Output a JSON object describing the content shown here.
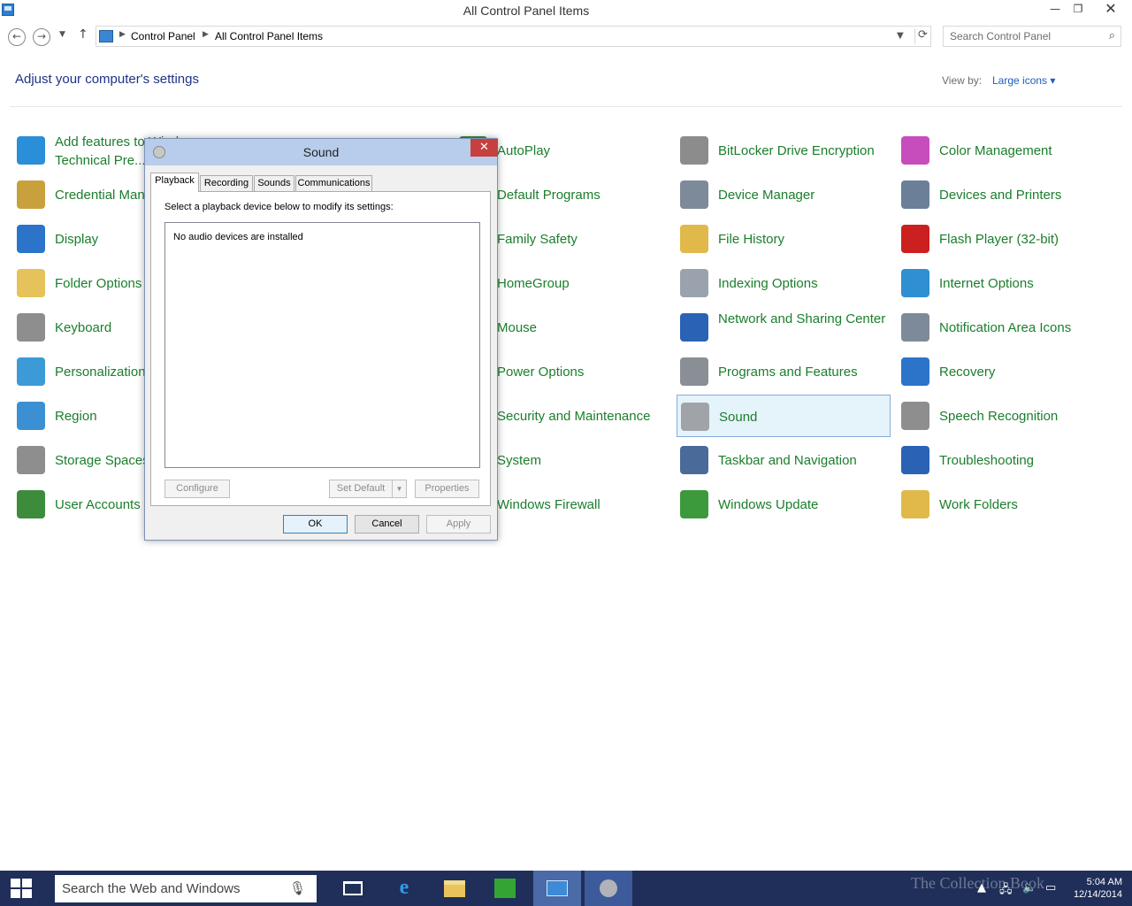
{
  "window": {
    "title": "All Control Panel Items",
    "controls": {
      "minimize": "—",
      "maximize": "❐",
      "close": "✕"
    }
  },
  "nav": {
    "back": "←",
    "forward": "→",
    "up": "↑",
    "breadcrumbs": [
      "Control Panel",
      "All Control Panel Items"
    ],
    "search_placeholder": "Search Control Panel"
  },
  "header": {
    "heading": "Adjust your computer's settings",
    "view_by_label": "View by:",
    "view_by_value": "Large icons"
  },
  "items": [
    {
      "label": "Add features to Windows Technical Pre...",
      "icon": "add-features-icon",
      "color": "#2a8ed8"
    },
    {
      "label": "AutoPlay",
      "icon": "autoplay-icon",
      "color": "#3c8c3c"
    },
    {
      "label": "BitLocker Drive Encryption",
      "icon": "bitlocker-icon",
      "color": "#8c8c8c"
    },
    {
      "label": "Color Management",
      "icon": "color-management-icon",
      "color": "#c74dbd"
    },
    {
      "label": "Credential Manager",
      "icon": "credential-manager-icon",
      "color": "#c9a13c"
    },
    {
      "label": "Default Programs",
      "icon": "default-programs-icon",
      "color": "#3a9c3a"
    },
    {
      "label": "Device Manager",
      "icon": "device-manager-icon",
      "color": "#7d8a99"
    },
    {
      "label": "Devices and Printers",
      "icon": "devices-printers-icon",
      "color": "#6b7f99"
    },
    {
      "label": "Display",
      "icon": "display-icon",
      "color": "#2b74c9"
    },
    {
      "label": "Family Safety",
      "icon": "family-safety-icon",
      "color": "#3fa13f"
    },
    {
      "label": "File History",
      "icon": "file-history-icon",
      "color": "#e1b84a"
    },
    {
      "label": "Flash Player (32-bit)",
      "icon": "flash-player-icon",
      "color": "#cc1f1f"
    },
    {
      "label": "Folder Options",
      "icon": "folder-options-icon",
      "color": "#e6c25a"
    },
    {
      "label": "HomeGroup",
      "icon": "homegroup-icon",
      "color": "#2a8ed8"
    },
    {
      "label": "Indexing Options",
      "icon": "indexing-options-icon",
      "color": "#9aa3ad"
    },
    {
      "label": "Internet Options",
      "icon": "internet-options-icon",
      "color": "#2f8fd1"
    },
    {
      "label": "Keyboard",
      "icon": "keyboard-icon",
      "color": "#8e8e8e"
    },
    {
      "label": "Mouse",
      "icon": "mouse-icon",
      "color": "#8e8e8e"
    },
    {
      "label": "Network and Sharing Center",
      "icon": "network-sharing-icon",
      "color": "#2a62b5"
    },
    {
      "label": "Notification Area Icons",
      "icon": "notification-area-icon",
      "color": "#7d8a99"
    },
    {
      "label": "Personalization",
      "icon": "personalization-icon",
      "color": "#3c9ad6"
    },
    {
      "label": "Power Options",
      "icon": "power-options-icon",
      "color": "#47a23c"
    },
    {
      "label": "Programs and Features",
      "icon": "programs-features-icon",
      "color": "#8a8f96"
    },
    {
      "label": "Recovery",
      "icon": "recovery-icon",
      "color": "#2b74c9"
    },
    {
      "label": "Region",
      "icon": "region-icon",
      "color": "#3d8fd4"
    },
    {
      "label": "Security and Maintenance",
      "icon": "security-maintenance-icon",
      "color": "#2a62b5"
    },
    {
      "label": "Sound",
      "icon": "sound-icon",
      "color": "#a0a4a8"
    },
    {
      "label": "Speech Recognition",
      "icon": "speech-recognition-icon",
      "color": "#8e8e8e"
    },
    {
      "label": "Storage Spaces",
      "icon": "storage-spaces-icon",
      "color": "#8e8e8e"
    },
    {
      "label": "System",
      "icon": "system-icon",
      "color": "#2b74c9"
    },
    {
      "label": "Taskbar and Navigation",
      "icon": "taskbar-navigation-icon",
      "color": "#4a6a9a"
    },
    {
      "label": "Troubleshooting",
      "icon": "troubleshooting-icon",
      "color": "#2a62b5"
    },
    {
      "label": "User Accounts",
      "icon": "user-accounts-icon",
      "color": "#3c8c3c"
    },
    {
      "label": "Windows Firewall",
      "icon": "windows-firewall-icon",
      "color": "#b8473c"
    },
    {
      "label": "Windows Update",
      "icon": "windows-update-icon",
      "color": "#3c9a3c"
    },
    {
      "label": "Work Folders",
      "icon": "work-folders-icon",
      "color": "#e1b84a"
    }
  ],
  "dialog": {
    "title": "Sound",
    "close": "✕",
    "tabs": [
      "Playback",
      "Recording",
      "Sounds",
      "Communications"
    ],
    "active_tab": "Playback",
    "instruction": "Select a playback device below to modify its settings:",
    "empty_message": "No audio devices are installed",
    "panel_buttons": {
      "configure": "Configure",
      "set_default": "Set Default",
      "properties": "Properties"
    },
    "buttons": {
      "ok": "OK",
      "cancel": "Cancel",
      "apply": "Apply"
    }
  },
  "taskbar": {
    "search_placeholder": "Search the Web and Windows",
    "apps": [
      "task-view",
      "internet-explorer",
      "file-explorer",
      "store",
      "control-panel",
      "sound"
    ],
    "watermark": "The Collection Book",
    "time": "5:04 AM",
    "date": "12/14/2014"
  }
}
